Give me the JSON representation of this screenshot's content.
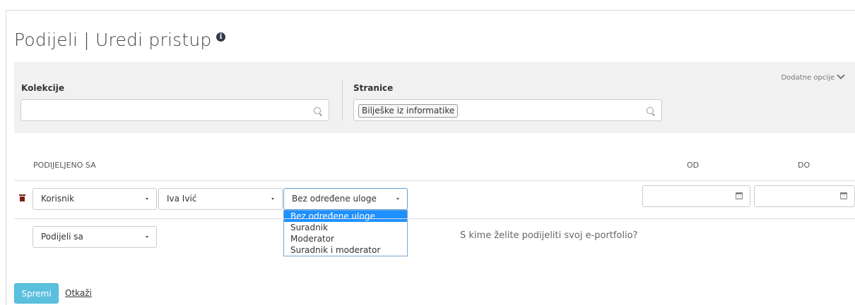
{
  "page": {
    "title": "Podijeli | Uredi pristup",
    "info_icon": "info-circle-icon"
  },
  "filters": {
    "extra_options_label": "Dodatne opcije",
    "collections": {
      "label": "Kolekcije",
      "value": "",
      "icon": "search-icon"
    },
    "pages": {
      "label": "Stranice",
      "tags": [
        "Bilješke iz informatike"
      ],
      "icon": "search-icon"
    }
  },
  "share_table": {
    "headers": {
      "shared_with": "PODIJELJENO SA",
      "from": "OD",
      "to": "DO"
    },
    "rows": [
      {
        "delete_icon": "trash-icon",
        "type": "Korisnik",
        "user": "Iva Ivić",
        "role": "Bez određene uloge",
        "from": "",
        "to": "",
        "date_icon": "calendar-icon"
      }
    ],
    "role_dropdown": {
      "options": [
        "Bez određene uloge",
        "Suradnik",
        "Moderator",
        "Suradnik i moderator"
      ],
      "selected_index": 0
    },
    "share_with_select": "Podijeli sa",
    "hint": "S kime želite podijeliti svoj e-portfolio?"
  },
  "actions": {
    "save_label": "Spremi",
    "cancel_label": "Otkaži"
  },
  "colors": {
    "accent_button": "#5bc0de",
    "dropdown_highlight": "#1e90ff",
    "delete_icon": "#7a1f14",
    "panel_bg": "#f1f1f1"
  }
}
